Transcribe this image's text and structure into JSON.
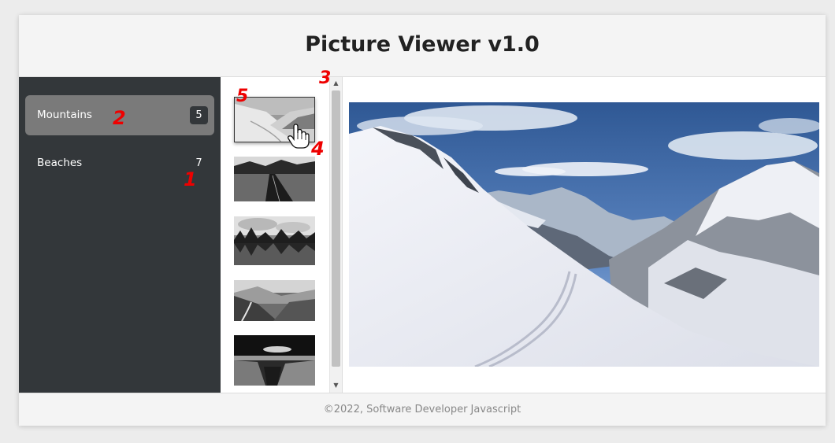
{
  "header": {
    "title": "Picture Viewer v1.0"
  },
  "sidebar": {
    "categories": [
      {
        "label": "Mountains",
        "count": "5",
        "active": true
      },
      {
        "label": "Beaches",
        "count": "7",
        "active": false
      }
    ]
  },
  "thumbnails": [
    {
      "icon": "snow-slope-thumbnail",
      "selected": true
    },
    {
      "icon": "road-thumbnail",
      "selected": false
    },
    {
      "icon": "lake-reflection-thumbnail",
      "selected": false
    },
    {
      "icon": "valley-path-thumbnail",
      "selected": false
    },
    {
      "icon": "canyon-thumbnail",
      "selected": false
    }
  ],
  "main_image": {
    "icon": "snowy-mountain-ski-track-photo"
  },
  "markers": [
    "1",
    "2",
    "3",
    "4",
    "5"
  ],
  "footer": {
    "text": "©2022, Software Developer Javascript"
  },
  "colors": {
    "sidebar": "#33373a",
    "active_item": "#7a7a7a",
    "marker": "#ee0000"
  }
}
